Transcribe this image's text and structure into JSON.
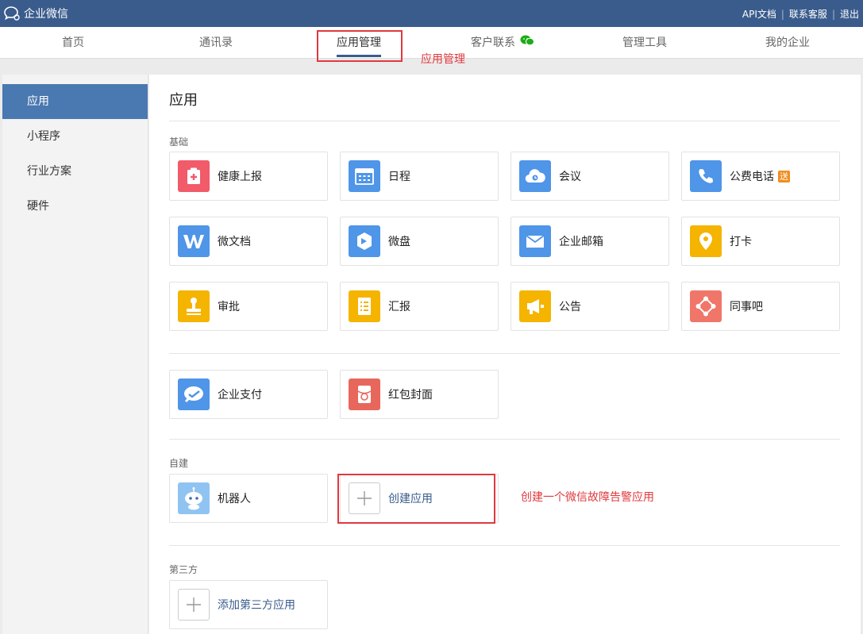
{
  "topbar": {
    "brand": "企业微信",
    "links": [
      "API文档",
      "联系客服",
      "退出"
    ]
  },
  "nav": {
    "items": [
      "首页",
      "通讯录",
      "应用管理",
      "客户联系",
      "管理工具",
      "我的企业"
    ],
    "active": "应用管理"
  },
  "annotations": {
    "nav": "应用管理",
    "create": "创建一个微信故障告警应用"
  },
  "sidebar": {
    "items": [
      "应用",
      "小程序",
      "行业方案",
      "硬件"
    ]
  },
  "main": {
    "title": "应用",
    "sections": {
      "basic": "基础",
      "custom": "自建",
      "third": "第三方"
    },
    "basic_apps": [
      {
        "label": "健康上报",
        "icon": "health-report-icon",
        "color": "#f15b6a"
      },
      {
        "label": "日程",
        "icon": "calendar-icon",
        "color": "#4f95e8"
      },
      {
        "label": "会议",
        "icon": "meeting-cloud-icon",
        "color": "#4f95e8"
      },
      {
        "label": "公费电话",
        "icon": "phone-icon",
        "color": "#4f95e8",
        "badge": "送"
      },
      {
        "label": "微文档",
        "icon": "doc-w-icon",
        "color": "#4f95e8"
      },
      {
        "label": "微盘",
        "icon": "drive-icon",
        "color": "#4f95e8"
      },
      {
        "label": "企业邮箱",
        "icon": "mail-icon",
        "color": "#4f95e8"
      },
      {
        "label": "打卡",
        "icon": "location-pin-icon",
        "color": "#f4b400"
      },
      {
        "label": "审批",
        "icon": "stamp-icon",
        "color": "#f4b400"
      },
      {
        "label": "汇报",
        "icon": "report-doc-icon",
        "color": "#f4b400"
      },
      {
        "label": "公告",
        "icon": "megaphone-icon",
        "color": "#f4b400"
      },
      {
        "label": "同事吧",
        "icon": "colleague-icon",
        "color": "#f0766a"
      }
    ],
    "extra_apps": [
      {
        "label": "企业支付",
        "icon": "pay-icon",
        "color": "#4f95e8"
      },
      {
        "label": "红包封面",
        "icon": "red-packet-icon",
        "color": "#e8675c"
      }
    ],
    "custom_apps": [
      {
        "label": "机器人",
        "icon": "robot-icon",
        "color": "#8fc4f2"
      },
      {
        "label": "创建应用",
        "icon": "plus-icon"
      }
    ],
    "third_apps": [
      {
        "label": "添加第三方应用",
        "icon": "plus-icon"
      }
    ]
  }
}
